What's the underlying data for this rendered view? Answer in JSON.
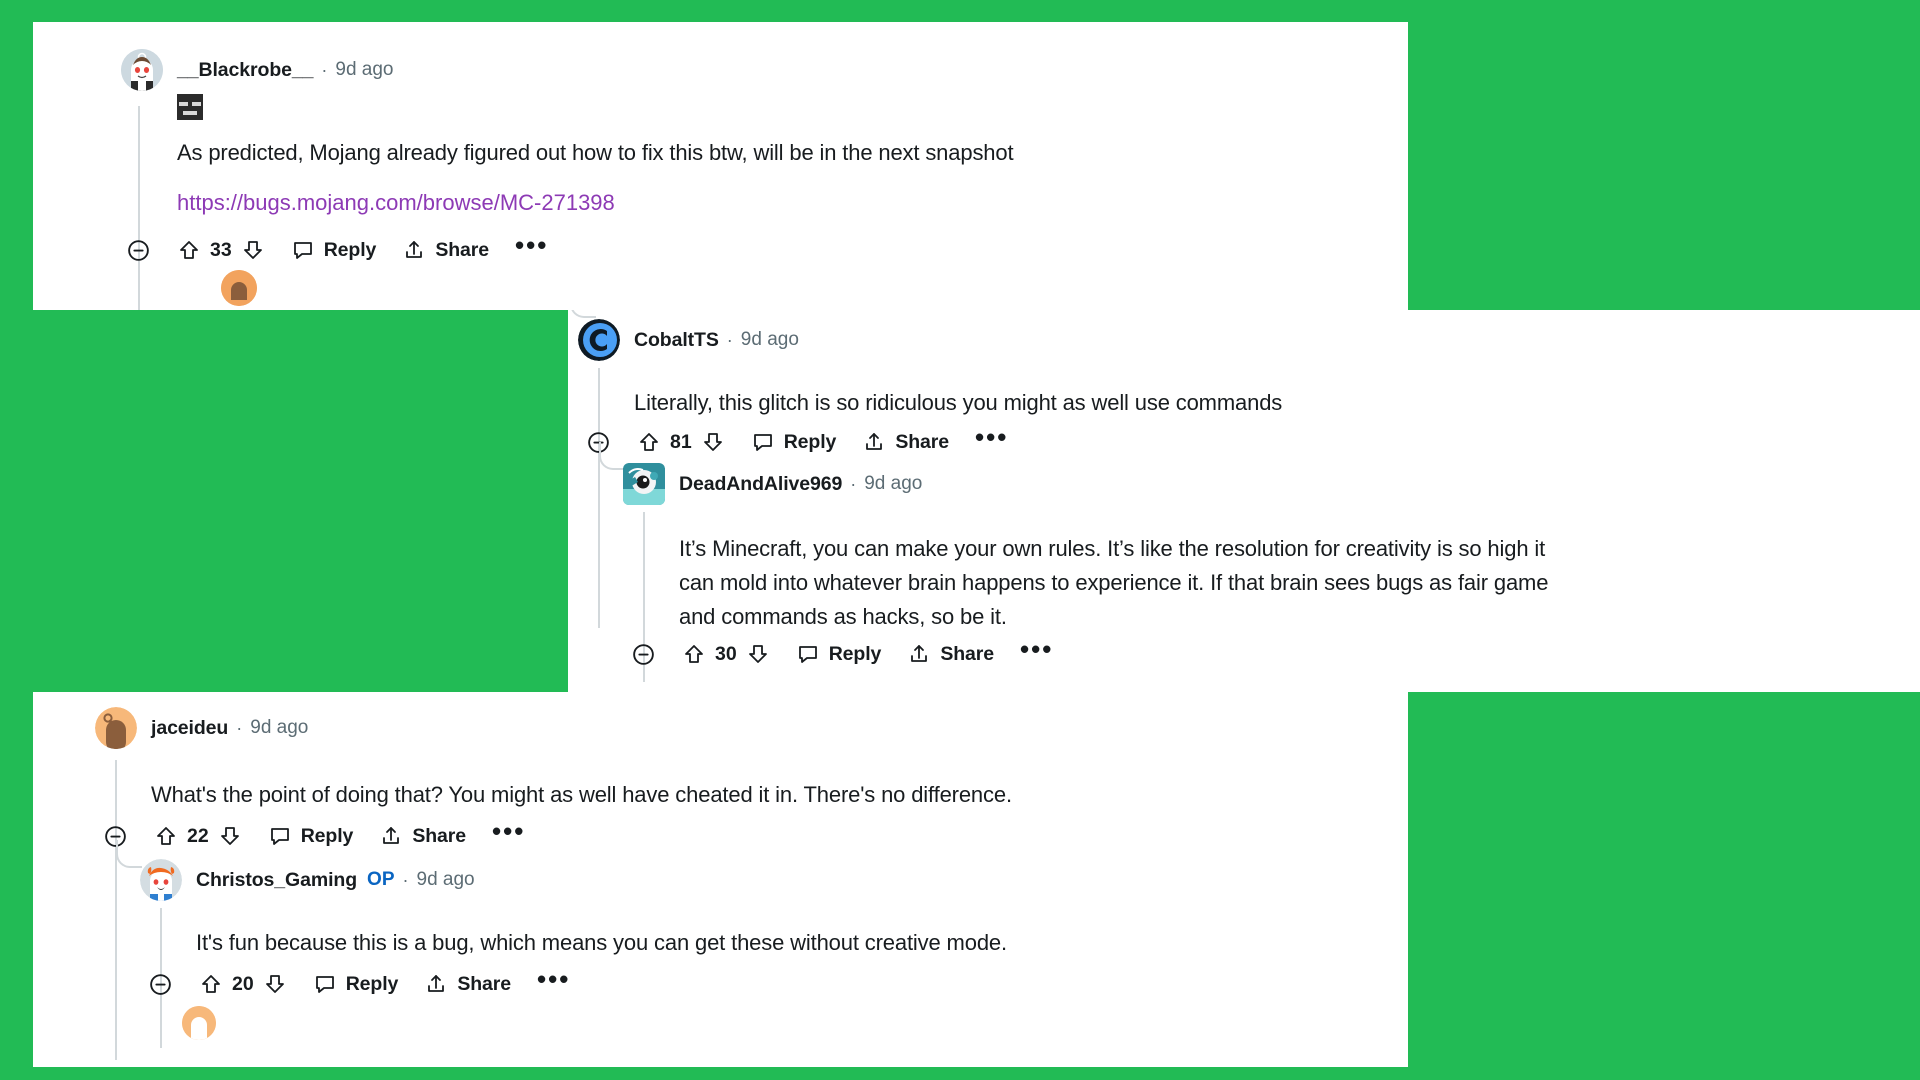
{
  "background_color": "#22bb55",
  "panel_color": "#ffffff",
  "colors": {
    "text": "#181c1f",
    "meta": "#5c6c74",
    "link_visited": "#8d3ab5",
    "op_blue": "#0a65c2",
    "rail": "#d2d8db"
  },
  "action_labels": {
    "collapse": "collapse-comment",
    "upvote": "upvote",
    "downvote": "downvote",
    "reply": "Reply",
    "share": "Share",
    "more": "•••"
  },
  "comments": [
    {
      "id": "blackrobe",
      "username": "__Blackrobe__",
      "separator": "·",
      "timestamp": "9d ago",
      "flair": "minecraft-enderman-flair",
      "op": false,
      "body": "As predicted, Mojang already figured out how to fix this btw, will be in the next snapshot",
      "link": "https://bugs.mojang.com/browse/MC-271398",
      "score": "33",
      "reply": "Reply",
      "share": "Share",
      "avatar": "snoo-avatar-blackrobe"
    },
    {
      "id": "cobaltts",
      "username": "CobaltTS",
      "separator": "·",
      "timestamp": "9d ago",
      "op": false,
      "body": "Literally, this glitch is so ridiculous you might as well use commands",
      "score": "81",
      "reply": "Reply",
      "share": "Share",
      "avatar": "cobalt-c-logo-avatar"
    },
    {
      "id": "deadandalive969",
      "username": "DeadAndAlive969",
      "separator": "·",
      "timestamp": "9d ago",
      "op": false,
      "body_lines": [
        "It’s Minecraft, you can make your own rules. It’s like the resolution for creativity is so high it",
        "can mold into whatever brain happens to experience it. If that brain sees bugs as fair game",
        "and commands as hacks, so be it."
      ],
      "score": "30",
      "reply": "Reply",
      "share": "Share",
      "avatar": "snoo-avatar-teal-skull"
    },
    {
      "id": "jaceideu",
      "username": "jaceideu",
      "separator": "·",
      "timestamp": "9d ago",
      "op": false,
      "body": "What's the point of doing that? You might as well have cheated it in. There's no difference.",
      "score": "22",
      "reply": "Reply",
      "share": "Share",
      "avatar": "snoo-avatar-orange"
    },
    {
      "id": "christos_gaming",
      "username": "Christos_Gaming",
      "op": true,
      "op_label": "OP",
      "separator": "·",
      "timestamp": "9d ago",
      "body": "It's fun because this is a bug, which means you can get these without creative mode.",
      "score": "20",
      "reply": "Reply",
      "share": "Share",
      "avatar": "snoo-avatar-orange-hair"
    }
  ]
}
